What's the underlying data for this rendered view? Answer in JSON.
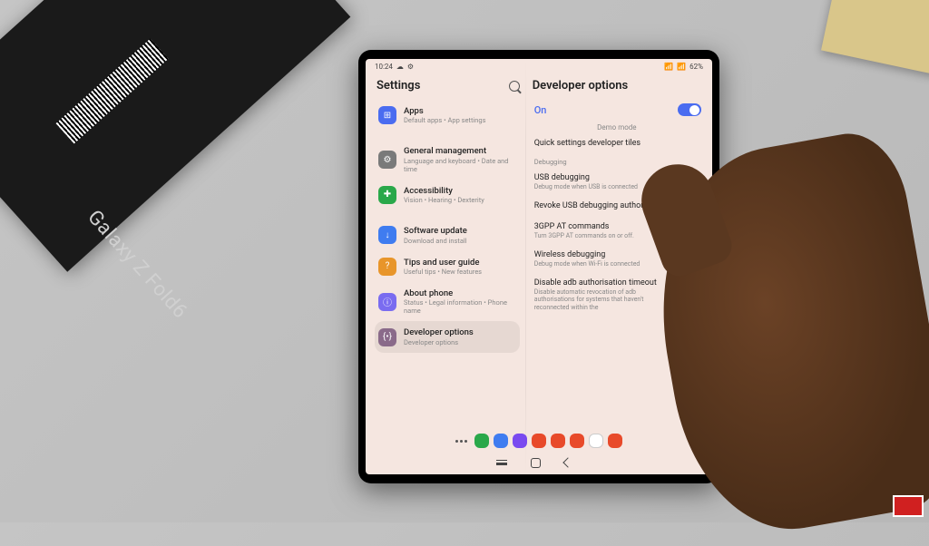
{
  "scene": {
    "box_brand": "Galaxy Z Fold6"
  },
  "status": {
    "time": "10:24",
    "battery": "62%"
  },
  "left": {
    "title": "Settings",
    "items": [
      {
        "title": "Apps",
        "sub": "Default apps • App settings",
        "color": "#4a6cf0",
        "glyph": "⊞"
      },
      {
        "title": "General management",
        "sub": "Language and keyboard • Date and time",
        "color": "#7a7a7a",
        "glyph": "⚙"
      },
      {
        "title": "Accessibility",
        "sub": "Vision • Hearing • Dexterity",
        "color": "#2aa84a",
        "glyph": "✚"
      },
      {
        "title": "Software update",
        "sub": "Download and install",
        "color": "#3f7cf0",
        "glyph": "↓"
      },
      {
        "title": "Tips and user guide",
        "sub": "Useful tips • New features",
        "color": "#e8952a",
        "glyph": "?"
      },
      {
        "title": "About phone",
        "sub": "Status • Legal information • Phone name",
        "color": "#7a6cf0",
        "glyph": "ⓘ"
      },
      {
        "title": "Developer options",
        "sub": "Developer options",
        "color": "#8a6a8a",
        "glyph": "{•}"
      }
    ],
    "selected_index": 6
  },
  "right": {
    "title": "Developer options",
    "master_label": "On",
    "master_on": true,
    "cut_item": "Demo mode",
    "section_debugging": "Debugging",
    "items_top": [
      {
        "title": "Quick settings developer tiles",
        "sub": ""
      }
    ],
    "items_debugging": [
      {
        "title": "USB debugging",
        "sub": "Debug mode when USB is connected",
        "toggle": true
      },
      {
        "title": "Revoke USB debugging authorisations",
        "sub": ""
      },
      {
        "title": "3GPP AT commands",
        "sub": "Turn 3GPP AT commands on or off.",
        "toggle": false
      },
      {
        "title": "Wireless debugging",
        "sub": "Debug mode when Wi-Fi is connected",
        "toggle": false
      },
      {
        "title": "Disable adb authorisation timeout",
        "sub": "Disable automatic revocation of adb authorisations for systems that haven't reconnected within the",
        "toggle": false
      }
    ]
  },
  "dock_colors": [
    "#2aa84a",
    "#3f7cf0",
    "#7a4af0",
    "#e84a2a",
    "#e84a2a",
    "#e84a2a",
    "#ffffff",
    "#e84a2a"
  ]
}
